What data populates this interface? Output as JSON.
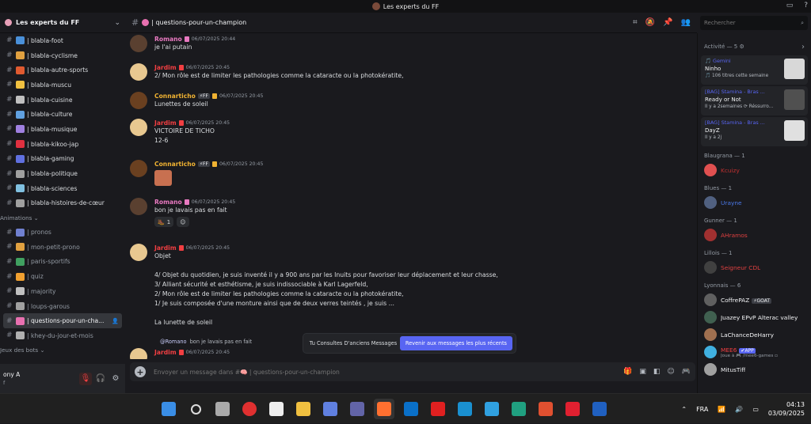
{
  "window": {
    "title": "Les experts du FF"
  },
  "server": {
    "name": "Les experts du FF"
  },
  "channels": [
    {
      "label": "| blabla-foot",
      "color": "#4a90d9",
      "dim": false
    },
    {
      "label": "| blabla-cyclisme",
      "color": "#e0a040",
      "dim": false
    },
    {
      "label": "| blabla-autre-sports",
      "color": "#e05a30",
      "dim": false
    },
    {
      "label": "| blabla-muscu",
      "color": "#f0c040",
      "dim": false
    },
    {
      "label": "| blabla-cuisine",
      "color": "#c0c0c0",
      "dim": false
    },
    {
      "label": "| blabla-culture",
      "color": "#60a0e0",
      "dim": false
    },
    {
      "label": "| blabla-musique",
      "color": "#a080e0",
      "dim": false
    },
    {
      "label": "| blabla-kikoo-jap",
      "color": "#e03040",
      "dim": false
    },
    {
      "label": "| blabla-gaming",
      "color": "#6070e0",
      "dim": false
    },
    {
      "label": "| blabla-politique",
      "color": "#a0a0a0",
      "dim": false
    },
    {
      "label": "| blabla-sciences",
      "color": "#80c0e0",
      "dim": false
    },
    {
      "label": "| blabla-histoires-de-cœur",
      "color": "#a0a0a0",
      "dim": false
    }
  ],
  "category_animations": "Animations ⌄",
  "anim_channels": [
    {
      "label": "| pronos",
      "color": "#7080d0",
      "dim": true,
      "sel": false
    },
    {
      "label": "| mon-petit-prono",
      "color": "#e0a040",
      "dim": true,
      "sel": false
    },
    {
      "label": "| paris-sportifs",
      "color": "#40a060",
      "dim": true,
      "sel": false
    },
    {
      "label": "| quiz",
      "color": "#f0a030",
      "dim": true,
      "sel": false
    },
    {
      "label": "| majority",
      "color": "#c0c0c0",
      "dim": true,
      "sel": false
    },
    {
      "label": "| loups-garous",
      "color": "#a0a0a0",
      "dim": true,
      "sel": false
    },
    {
      "label": "| questions-pour-un-cha...",
      "color": "#e870b0",
      "dim": false,
      "sel": true
    },
    {
      "label": "| khey-du-jour-et-mois",
      "color": "#b0b0b0",
      "dim": true,
      "sel": false
    }
  ],
  "category_bots": "Jeux des bots ⌄",
  "user": {
    "name": "ony A",
    "status": "f"
  },
  "channel_header": {
    "name": "| questions-pour-un-champion"
  },
  "search": {
    "placeholder": "Rechercher"
  },
  "messages": [
    {
      "name": "Romano",
      "color": "#e879c0",
      "badge": "",
      "time": "06/07/2025 20:44",
      "text": "je l'ai putain",
      "av": "#5a4030"
    },
    {
      "name": "Jardim",
      "color": "#f23f42",
      "badge": "",
      "time": "06/07/2025 20:45",
      "text": "2/ Mon rôle est de limiter les pathologies comme la cataracte ou la photokératite,",
      "av": "#e8c890"
    },
    {
      "name": "Connarticho",
      "color": "#f0b232",
      "badge": "⚡FF",
      "time": "06/07/2025 20:45",
      "text": "Lunettes de soleil",
      "av": "#6a4020"
    },
    {
      "name": "Jardim",
      "color": "#f23f42",
      "badge": "",
      "time": "06/07/2025 20:45",
      "text": "VICTOIRE DE TICHO\n12-6",
      "av": "#e8c890"
    },
    {
      "name": "Connarticho",
      "color": "#f0b232",
      "badge": "⚡FF",
      "time": "06/07/2025 20:45",
      "text": "",
      "av": "#6a4020"
    },
    {
      "name": "Romano",
      "color": "#e879c0",
      "badge": "",
      "time": "06/07/2025 20:45",
      "text": "bon je lavais pas en fait",
      "av": "#5a4030",
      "reaction": "1"
    },
    {
      "name": "Jardim",
      "color": "#f23f42",
      "badge": "",
      "time": "06/07/2025 20:45",
      "text": "Objet\n\n4/ Objet du quotidien, je suis inventé il y a 900 ans par les Inuits pour favoriser leur déplacement et leur chasse,\n3/ Alliant sécurité et esthétisme, je suis indissociable à Karl Lagerfeld,\n2/ Mon rôle est de limiter les pathologies comme la cataracte ou la photokératite,\n1/ Je suis composée d'une monture ainsi que de deux verres teintés , je suis ...\n\nLa lunette de soleil",
      "av": "#e8c890"
    },
    {
      "name": "Jardim",
      "color": "#f23f42",
      "badge": "",
      "time": "06/07/2025 20:45",
      "text": "",
      "av": "#e8c890",
      "reply_to": "@Romano",
      "reply_text": "bon je lavais pas en fait"
    }
  ],
  "jump": {
    "text": "Tu Consultes D'anciens Messages",
    "button": "Revenir aux messages les plus récents"
  },
  "composer": {
    "placeholder": "Envoyer un message dans #🧠 | questions-pour-un-champion"
  },
  "activity": {
    "title": "Activité — 5 ⚙",
    "cards": [
      {
        "src": "🎵 Gemini",
        "main": "Ninho",
        "sub": "🎵 106 titres cette semaine",
        "thumb": "#d8d8d8"
      },
      {
        "src": "[BAG] Stamina - Bras ...",
        "main": "Ready or Not",
        "sub": "Il y a 2semaines  ⟳ Réssurro...",
        "thumb": "#505050"
      },
      {
        "src": "[BAG] Stamina - Bras ...",
        "main": "DayZ",
        "sub": "Il y a 2j",
        "thumb": "#e0e0e0"
      }
    ]
  },
  "roles": [
    {
      "title": "Blaugrana — 1",
      "members": [
        {
          "name": "Kcuizy",
          "color": "#c03030",
          "av": "#e05050"
        }
      ]
    },
    {
      "title": "Blues — 1",
      "members": [
        {
          "name": "Urayne",
          "color": "#4a78e8",
          "av": "#506080"
        }
      ]
    },
    {
      "title": "Gunner — 1",
      "members": [
        {
          "name": "AHramos",
          "color": "#e04040",
          "av": "#a03030"
        }
      ]
    },
    {
      "title": "Lillois — 1",
      "members": [
        {
          "name": "Seigneur CDL",
          "color": "#e04040",
          "av": "#404040"
        }
      ]
    },
    {
      "title": "Lyonnais — 6",
      "members": [
        {
          "name": "CoffrePAZ",
          "color": "#f2f3f5",
          "av": "#606060",
          "tag": "⚡GOAT"
        },
        {
          "name": "Juazey EPvP Alterac valley",
          "color": "#f2f3f5",
          "av": "#406050"
        },
        {
          "name": "LaChanceDeHarry",
          "color": "#f2f3f5",
          "av": "#a07050"
        },
        {
          "name": "MEE6",
          "color": "#f23f42",
          "av": "#40b0e0",
          "tag": "✔APP",
          "sub": "Joue à 🎮 /mee6-games ▫"
        },
        {
          "name": "MitusTiff",
          "color": "#f2f3f5",
          "av": "#a0a0a0"
        }
      ]
    }
  ],
  "taskbar": {
    "lang": "FRA",
    "time": "04:13",
    "date": "03/09/2025"
  }
}
